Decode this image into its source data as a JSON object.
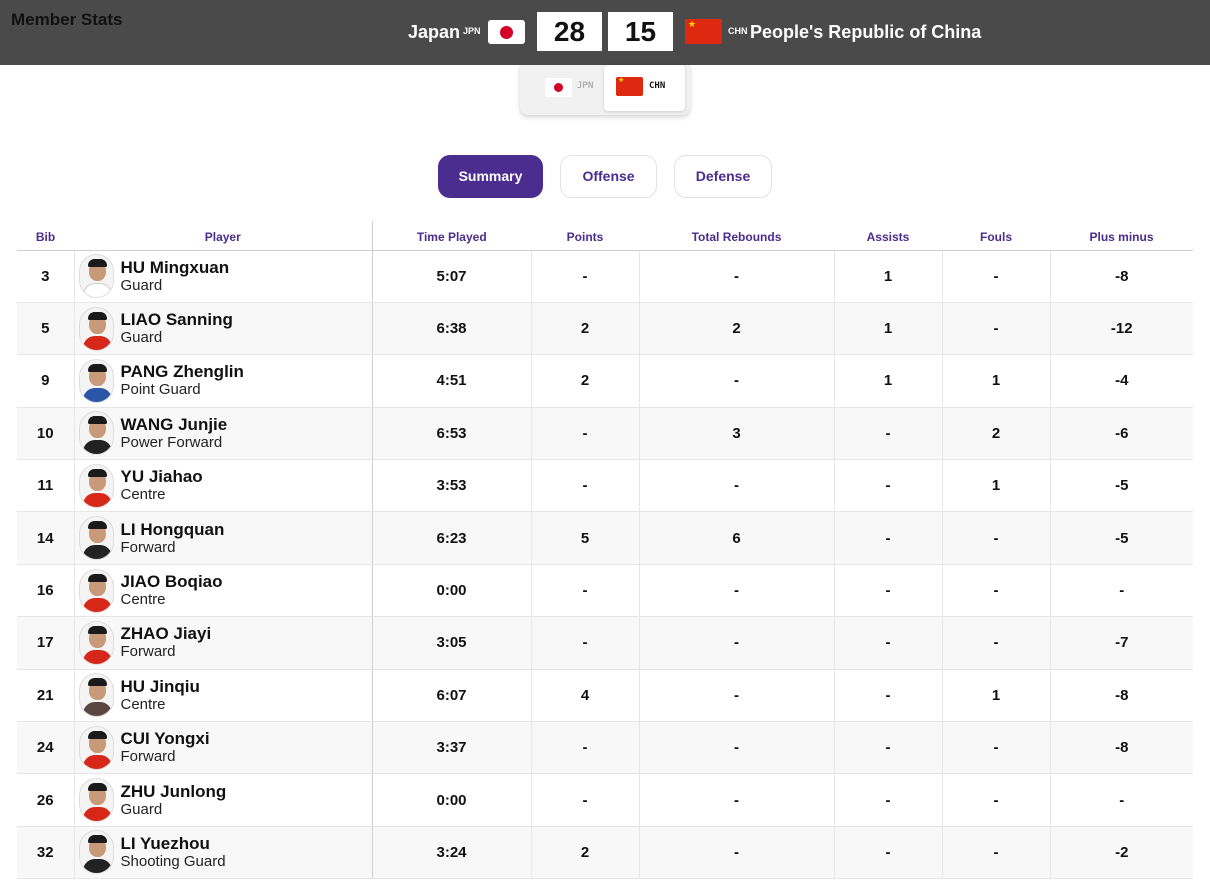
{
  "header": {
    "title": "Member Stats",
    "home": {
      "name": "Japan",
      "code": "JPN",
      "score": "28"
    },
    "away": {
      "name": "People's Republic of China",
      "code": "CHN",
      "score": "15"
    }
  },
  "team_toggle": {
    "home_code": "JPN",
    "away_code": "CHN",
    "selected": "CHN"
  },
  "tabs": [
    {
      "label": "Summary",
      "active": true
    },
    {
      "label": "Offense",
      "active": false
    },
    {
      "label": "Defense",
      "active": false
    }
  ],
  "table": {
    "columns": [
      "Bib",
      "Player",
      "Time Played",
      "Points",
      "Total Rebounds",
      "Assists",
      "Fouls",
      "Plus minus"
    ],
    "rows": [
      {
        "bib": "3",
        "name": "HU Mingxuan",
        "position": "Guard",
        "time": "5:07",
        "points": "-",
        "rebounds": "-",
        "assists": "1",
        "fouls": "-",
        "plus_minus": "-8",
        "jersey": "#ffffff"
      },
      {
        "bib": "5",
        "name": "LIAO Sanning",
        "position": "Guard",
        "time": "6:38",
        "points": "2",
        "rebounds": "2",
        "assists": "1",
        "fouls": "-",
        "plus_minus": "-12",
        "jersey": "#d62718"
      },
      {
        "bib": "9",
        "name": "PANG Zhenglin",
        "position": "Point Guard",
        "time": "4:51",
        "points": "2",
        "rebounds": "-",
        "assists": "1",
        "fouls": "1",
        "plus_minus": "-4",
        "jersey": "#2b56a8"
      },
      {
        "bib": "10",
        "name": "WANG Junjie",
        "position": "Power Forward",
        "time": "6:53",
        "points": "-",
        "rebounds": "3",
        "assists": "-",
        "fouls": "2",
        "plus_minus": "-6",
        "jersey": "#222222"
      },
      {
        "bib": "11",
        "name": "YU Jiahao",
        "position": "Centre",
        "time": "3:53",
        "points": "-",
        "rebounds": "-",
        "assists": "-",
        "fouls": "1",
        "plus_minus": "-5",
        "jersey": "#d62718"
      },
      {
        "bib": "14",
        "name": "LI Hongquan",
        "position": "Forward",
        "time": "6:23",
        "points": "5",
        "rebounds": "6",
        "assists": "-",
        "fouls": "-",
        "plus_minus": "-5",
        "jersey": "#222222"
      },
      {
        "bib": "16",
        "name": "JIAO Boqiao",
        "position": "Centre",
        "time": "0:00",
        "points": "-",
        "rebounds": "-",
        "assists": "-",
        "fouls": "-",
        "plus_minus": "-",
        "jersey": "#d62718"
      },
      {
        "bib": "17",
        "name": "ZHAO Jiayi",
        "position": "Forward",
        "time": "3:05",
        "points": "-",
        "rebounds": "-",
        "assists": "-",
        "fouls": "-",
        "plus_minus": "-7",
        "jersey": "#d62718"
      },
      {
        "bib": "21",
        "name": "HU Jinqiu",
        "position": "Centre",
        "time": "6:07",
        "points": "4",
        "rebounds": "-",
        "assists": "-",
        "fouls": "1",
        "plus_minus": "-8",
        "jersey": "#5a4640"
      },
      {
        "bib": "24",
        "name": "CUI Yongxi",
        "position": "Forward",
        "time": "3:37",
        "points": "-",
        "rebounds": "-",
        "assists": "-",
        "fouls": "-",
        "plus_minus": "-8",
        "jersey": "#d62718"
      },
      {
        "bib": "26",
        "name": "ZHU Junlong",
        "position": "Guard",
        "time": "0:00",
        "points": "-",
        "rebounds": "-",
        "assists": "-",
        "fouls": "-",
        "plus_minus": "-",
        "jersey": "#d62718"
      },
      {
        "bib": "32",
        "name": "LI Yuezhou",
        "position": "Shooting Guard",
        "time": "3:24",
        "points": "2",
        "rebounds": "-",
        "assists": "-",
        "fouls": "-",
        "plus_minus": "-2",
        "jersey": "#222222"
      }
    ]
  }
}
